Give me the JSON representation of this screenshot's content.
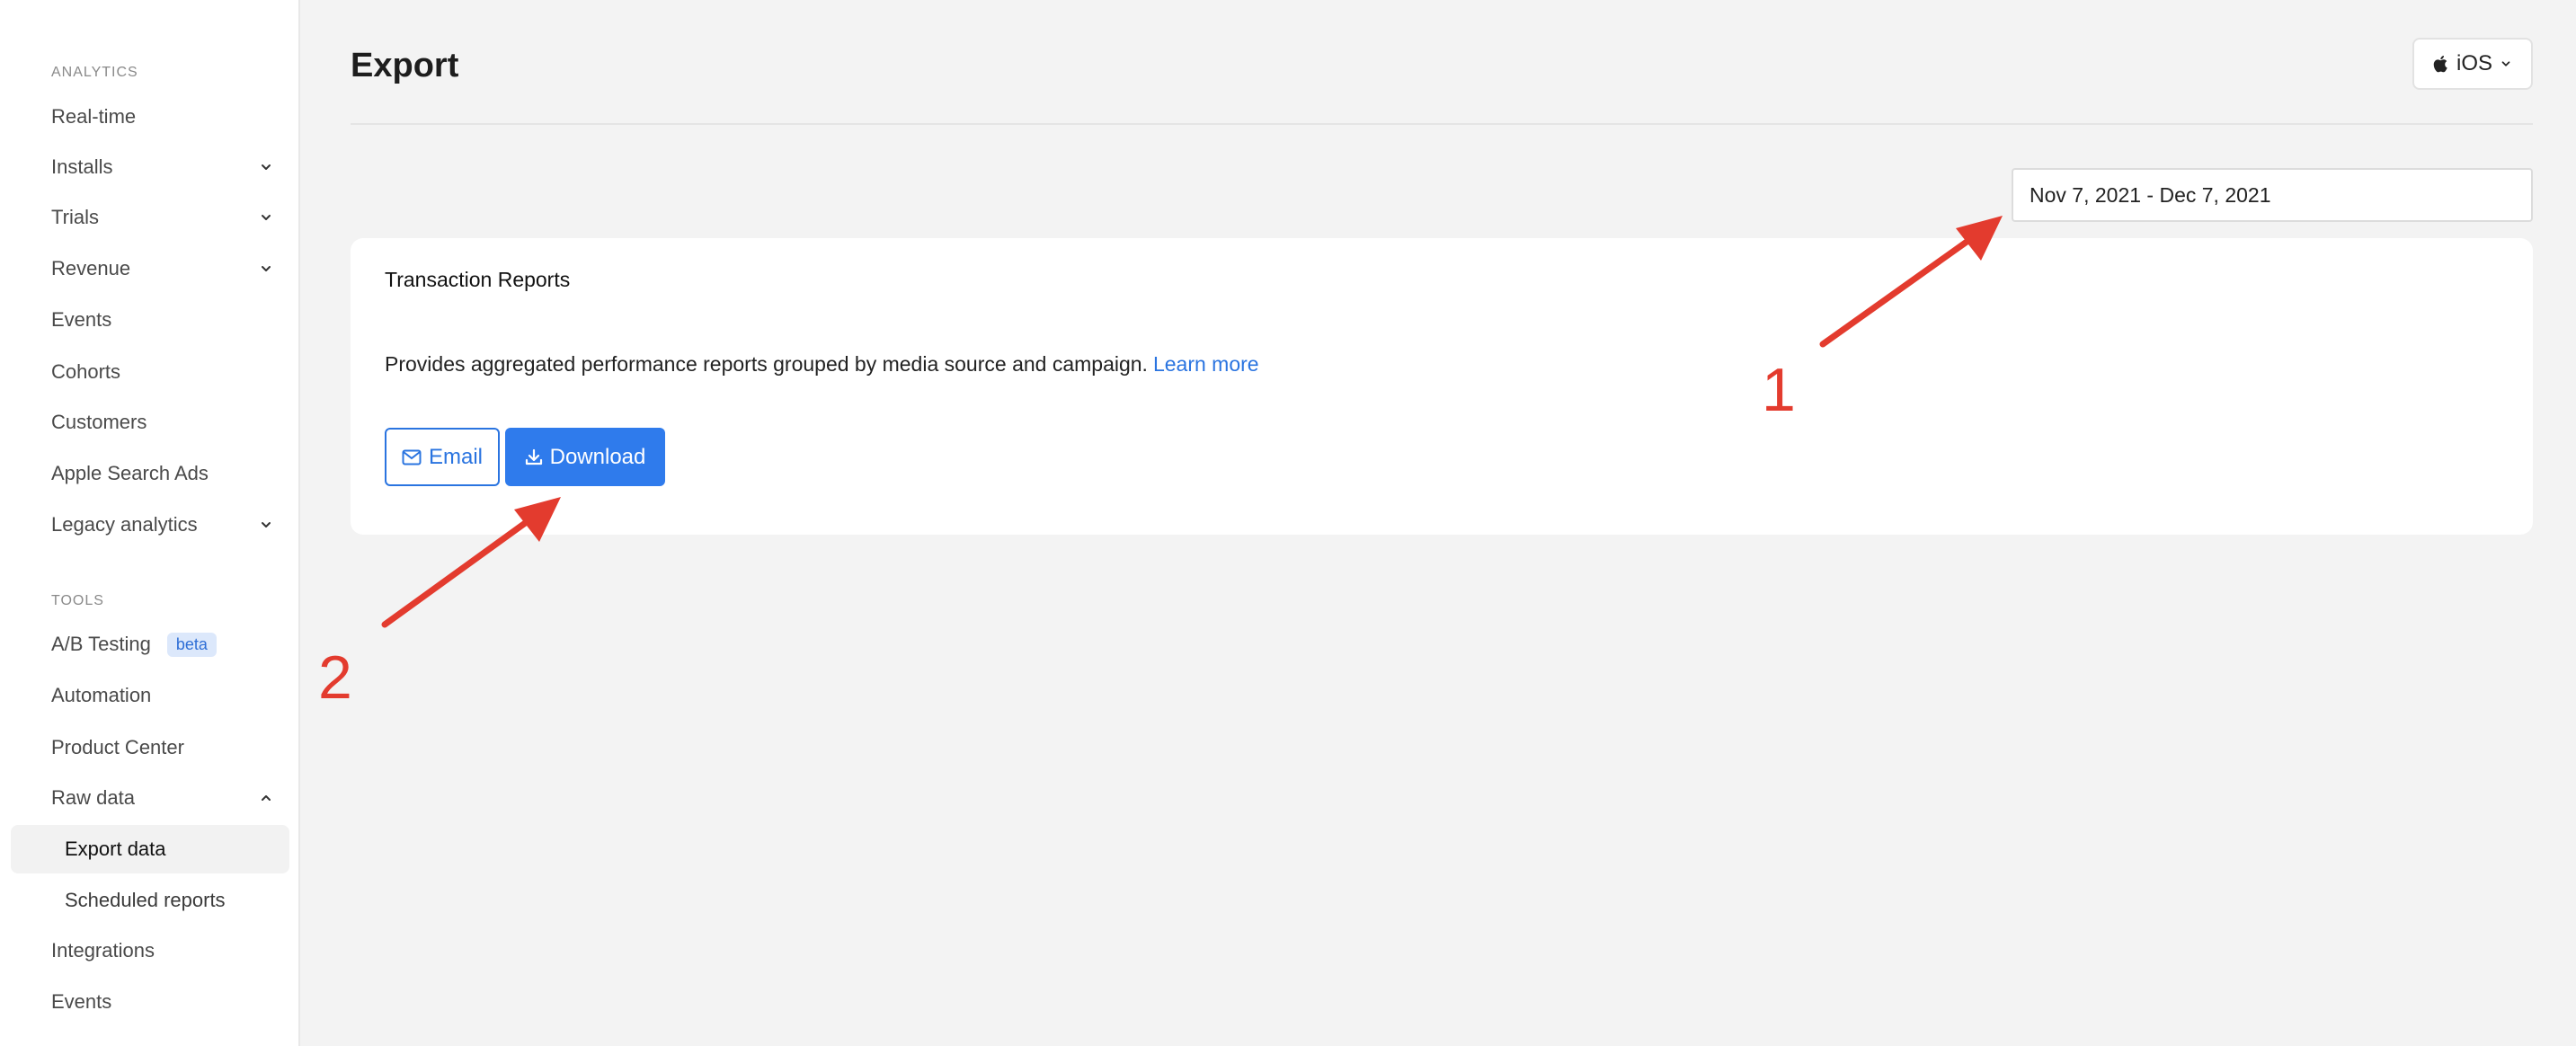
{
  "sidebar": {
    "analytics_title": "ANALYTICS",
    "analytics_items": [
      {
        "label": "Real-time"
      },
      {
        "label": "Installs"
      },
      {
        "label": "Trials"
      },
      {
        "label": "Revenue"
      },
      {
        "label": "Events"
      },
      {
        "label": "Cohorts"
      },
      {
        "label": "Customers"
      },
      {
        "label": "Apple Search Ads"
      },
      {
        "label": "Legacy analytics"
      }
    ],
    "tools_title": "TOOLS",
    "tools_items": [
      {
        "label": "A/B Testing",
        "badge": "beta"
      },
      {
        "label": "Automation"
      },
      {
        "label": "Product Center"
      },
      {
        "label": "Raw data"
      },
      {
        "label": "Export data"
      },
      {
        "label": "Scheduled reports"
      },
      {
        "label": "Integrations"
      },
      {
        "label": "Events"
      }
    ]
  },
  "header": {
    "title": "Export",
    "platform": "iOS"
  },
  "date_range": {
    "value": "Nov 7, 2021 - Dec 7, 2021"
  },
  "card": {
    "title": "Transaction Reports",
    "description": "Provides aggregated performance reports grouped by media source and campaign.",
    "learn_more": "Learn more",
    "email_label": "Email",
    "download_label": "Download"
  },
  "annotations": {
    "label_1": "1",
    "label_2": "2",
    "color": "#e33b2e"
  },
  "colors": {
    "accent": "#2f7bec",
    "link": "#2a74e0",
    "annotation": "#e33b2e"
  }
}
